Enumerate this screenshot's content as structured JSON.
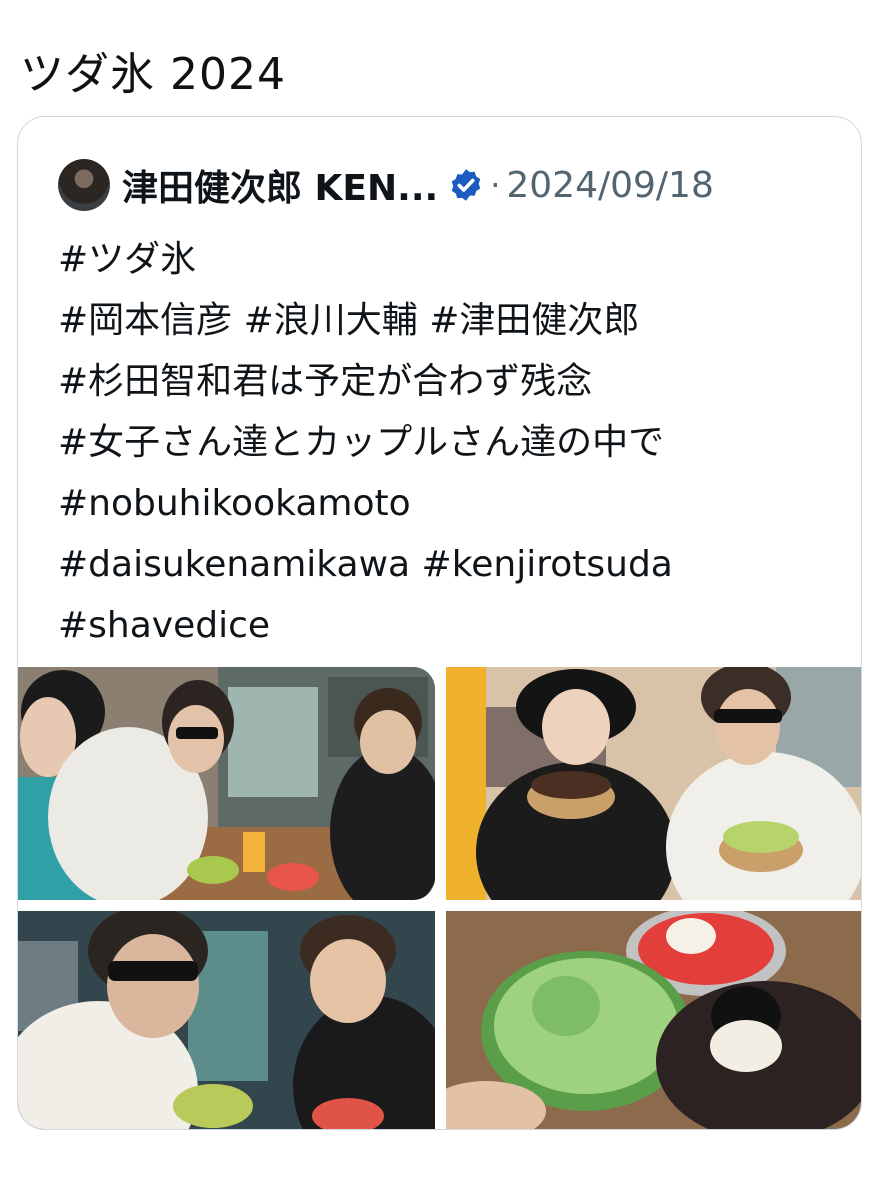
{
  "page": {
    "title": "ツダ氷 2024"
  },
  "post": {
    "author": "津田健次郎 KEN...",
    "separator": "·",
    "date": "2024/09/18",
    "lines": [
      "#ツダ氷",
      "#岡本信彦 #浪川大輔 #津田健次郎",
      "#杉田智和君は予定が合わず残念",
      "#女子さん達とカップルさん達の中で",
      "#nobuhikookamoto",
      "#daisukenamikawa #kenjirotsuda",
      "#shavedice"
    ]
  },
  "icons": {
    "avatar": "author-avatar",
    "verified": "verified-badge-icon"
  },
  "colors": {
    "verified": "#1d5bbf",
    "border": "#cfd9de",
    "muted": "#536471"
  }
}
